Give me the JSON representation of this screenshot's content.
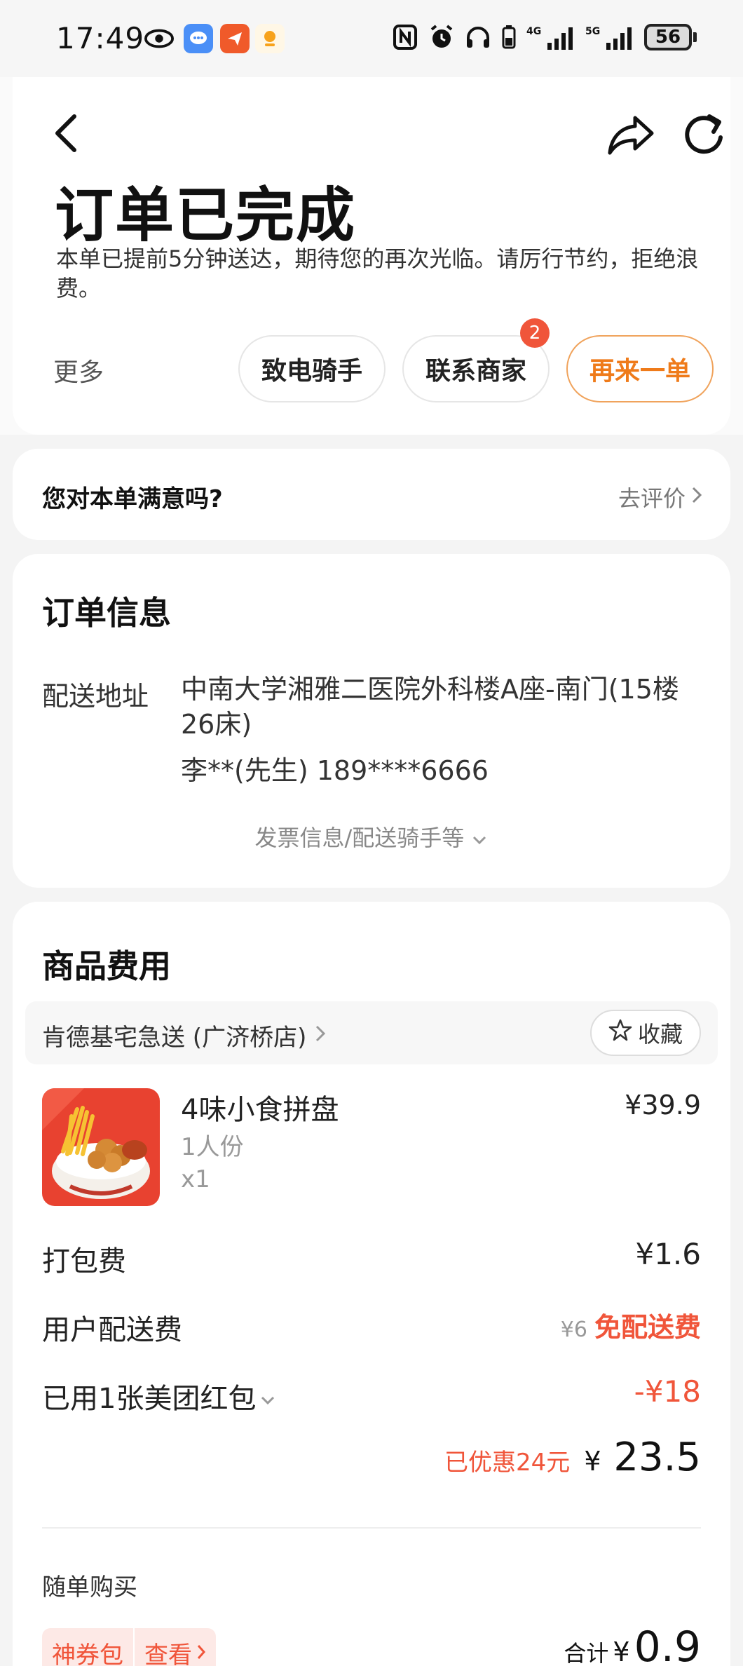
{
  "status_bar": {
    "time": "17:49",
    "battery": "56",
    "network_4g": "4G",
    "network_5g": "5G"
  },
  "header": {
    "title": "订单已完成",
    "subtitle": "本单已提前5分钟送达，期待您的再次光临。请厉行节约，拒绝浪费。",
    "more": "更多",
    "rider_button": "致电骑手",
    "merchant_button": "联系商家",
    "merchant_badge": "2",
    "reorder_button": "再来一单"
  },
  "satisfaction": {
    "question": "您对本单满意吗?",
    "link": "去评价"
  },
  "order_info": {
    "title": "订单信息",
    "address_label": "配送地址",
    "address": "中南大学湘雅二医院外科楼A座-南门(15楼26床)",
    "contact": "李**(先生) 189****6666",
    "more_link": "发票信息/配送骑手等"
  },
  "goods": {
    "title": "商品费用",
    "store_name": "肯德基宅急送 (广济桥店)",
    "favorite_label": "收藏",
    "product": {
      "name": "4味小食拼盘",
      "spec": "1人份",
      "qty": "x1",
      "price": "¥39.9"
    },
    "packing_label": "打包费",
    "packing_value": "¥1.6",
    "delivery_label": "用户配送费",
    "delivery_original": "¥6",
    "delivery_free": "免配送费",
    "redpacket_label": "已用1张美团红包",
    "redpacket_value": "-¥18",
    "saved_text": "已优惠24元",
    "total_yen": "¥",
    "total_amount": "23.5",
    "addon_title": "随单购买",
    "addon_tag": "神券包",
    "addon_view": "查看",
    "addon_total_label": "合计",
    "addon_total_yen": "¥",
    "addon_total_amount": "0.9"
  },
  "colors": {
    "accent_orange": "#ef7b1a",
    "discount_red": "#f0553a"
  }
}
